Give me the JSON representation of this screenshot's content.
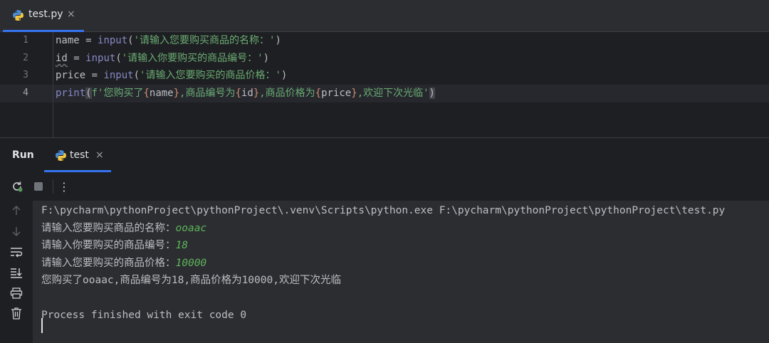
{
  "editor_tab": {
    "label": "test.py",
    "close": "×"
  },
  "editor": {
    "line_numbers": [
      "1",
      "2",
      "3",
      "4"
    ],
    "lines": [
      {
        "var": "name",
        "op": " = ",
        "fn": "input",
        "open": "(",
        "str": "'请输入您要购买商品的名称：'",
        "close": ")"
      },
      {
        "var": "id",
        "op": " = ",
        "fn": "input",
        "open": "(",
        "str": "'请输入你要购买的商品编号：'",
        "close": ")"
      },
      {
        "var": "price",
        "op": " = ",
        "fn": "input",
        "open": "(",
        "str": "'请输入您要购买的商品价格：'",
        "close": ")"
      },
      {
        "fn": "print",
        "open": "(",
        "prefix": "f'您购买了",
        "b1o": "{",
        "v1": "name",
        "b1c": "}",
        "s2": ",商品编号为",
        "b2o": "{",
        "v2": "id",
        "b2c": "}",
        "s3": ",商品价格为",
        "b3o": "{",
        "v3": "price",
        "b3c": "}",
        "s4": ",欢迎下次光临'",
        "close": ")"
      }
    ]
  },
  "run_window": {
    "title": "Run",
    "tab_label": "test",
    "tab_close": "×",
    "toolbar_more": "⋮",
    "console": {
      "command": "F:\\pycharm\\pythonProject\\pythonProject\\.venv\\Scripts\\python.exe F:\\pycharm\\pythonProject\\pythonProject\\test.py",
      "prompt1": "请输入您要购买商品的名称：",
      "input1": "ooaac",
      "prompt2": "请输入你要购买的商品编号：",
      "input2": "18",
      "prompt3": "请输入您要购买的商品价格：",
      "input3": "10000",
      "result": "您购买了ooaac,商品编号为18,商品价格为10000,欢迎下次光临",
      "exit": "Process finished with exit code 0"
    }
  },
  "icons": {
    "python": "python-icon",
    "rerun": "rerun-icon",
    "stop": "stop-icon",
    "up": "arrow-up-icon",
    "down": "arrow-down-icon",
    "wrap": "soft-wrap-icon",
    "scroll_end": "scroll-to-end-icon",
    "print": "print-icon",
    "trash": "trash-icon"
  },
  "colors": {
    "accent": "#3574f0",
    "string": "#6aab73",
    "builtin": "#8888c6",
    "brace": "#cf8e6d",
    "console_input": "#5fb45c"
  }
}
